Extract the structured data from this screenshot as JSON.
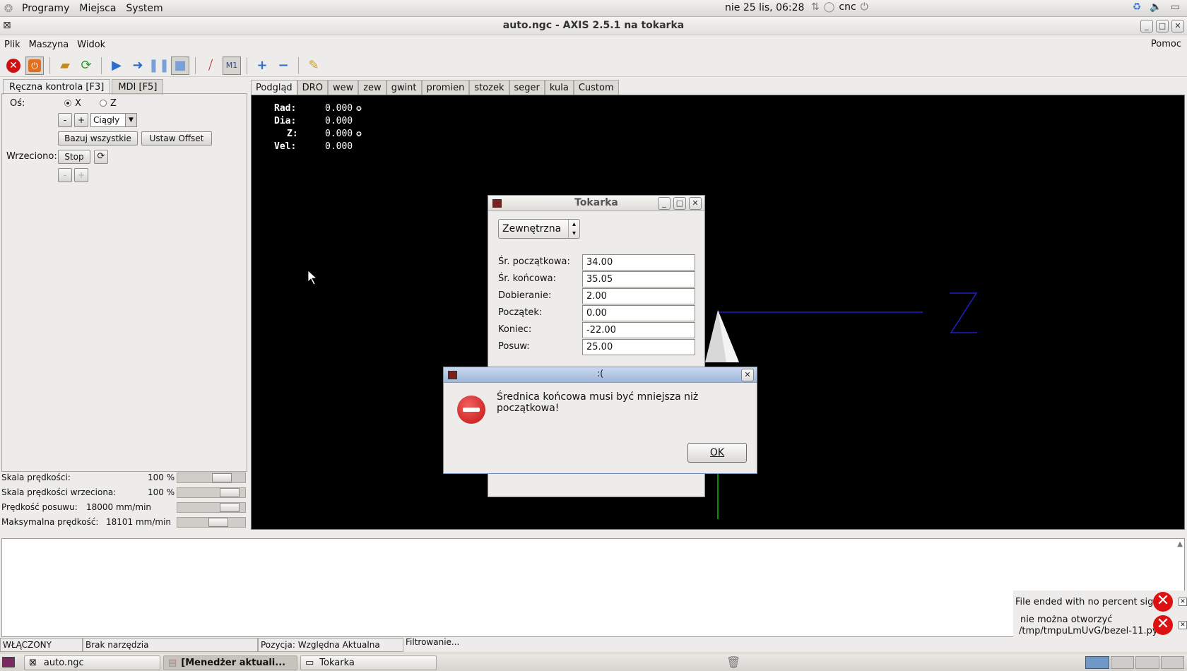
{
  "top_panel": {
    "menus": [
      "Programy",
      "Miejsca",
      "System"
    ],
    "clock": "nie 25 lis, 06:28",
    "user": "cnc"
  },
  "window": {
    "title": "auto.ngc - AXIS 2.5.1 na tokarka"
  },
  "menubar": {
    "items": [
      "Plik",
      "Maszyna",
      "Widok"
    ],
    "help": "Pomoc"
  },
  "left_tabs": [
    "Ręczna kontrola [F3]",
    "MDI [F5]"
  ],
  "manual": {
    "axis_label": "Oś:",
    "axis_x": "X",
    "axis_z": "Z",
    "minus": "-",
    "plus": "+",
    "jog_mode": "Ciągły",
    "home_all": "Bazuj wszystkie",
    "set_offset": "Ustaw Offset",
    "spindle_label": "Wrzeciono:",
    "spindle_stop": "Stop"
  },
  "sliders": [
    {
      "label": "Skala prędkości:",
      "value": "100 %",
      "level": 0.72
    },
    {
      "label": "Skala prędkości wrzeciona:",
      "value": "100 %",
      "level": 0.88
    },
    {
      "label": "Prędkość posuwu:",
      "value": "18000 mm/min",
      "level": 0.88
    },
    {
      "label": "Maksymalna prędkość:",
      "value": "18101 mm/min",
      "level": 0.64
    }
  ],
  "right_tabs": [
    "Podgląd",
    "DRO",
    "wew",
    "zew",
    "gwint",
    "promien",
    "stozek",
    "seger",
    "kula",
    "Custom"
  ],
  "dro": [
    {
      "label": "Rad:",
      "value": "0.000"
    },
    {
      "label": "Dia:",
      "value": "0.000"
    },
    {
      "label": "Z:",
      "value": "0.000"
    },
    {
      "label": "Vel:",
      "value": "0.000"
    }
  ],
  "tokarka": {
    "title": "Tokarka",
    "mode": "Zewnętrzna",
    "fields": [
      {
        "label": "Śr. początkowa:",
        "value": "34.00"
      },
      {
        "label": "Śr. końcowa:",
        "value": "35.05"
      },
      {
        "label": "Dobieranie:",
        "value": "2.00"
      },
      {
        "label": "Początek:",
        "value": "0.00"
      },
      {
        "label": "Koniec:",
        "value": "-22.00"
      },
      {
        "label": "Posuw:",
        "value": "25.00"
      }
    ]
  },
  "error_dialog": {
    "title": ":(",
    "message": "Średnica końcowa musi być mniejsza niż początkowa!",
    "ok": "OK"
  },
  "notifications": [
    {
      "text": "File ended with no percent sign"
    },
    {
      "line1": "nie można otworzyć",
      "line2": "/tmp/tmpuLmUvG/bezel-11.py"
    }
  ],
  "status_bar": {
    "state": "WŁĄCZONY",
    "tool": "Brak narzędzia",
    "position": "Pozycja: Względna Aktualna",
    "filter": "Filtrowanie..."
  },
  "taskbar": [
    "auto.ngc",
    "[Menedżer aktuali...",
    "Tokarka"
  ],
  "colors": {
    "preview_bg": "#000000",
    "z_axis": "#2020c8",
    "x_axis": "#00c000",
    "error": "#cc1111"
  }
}
